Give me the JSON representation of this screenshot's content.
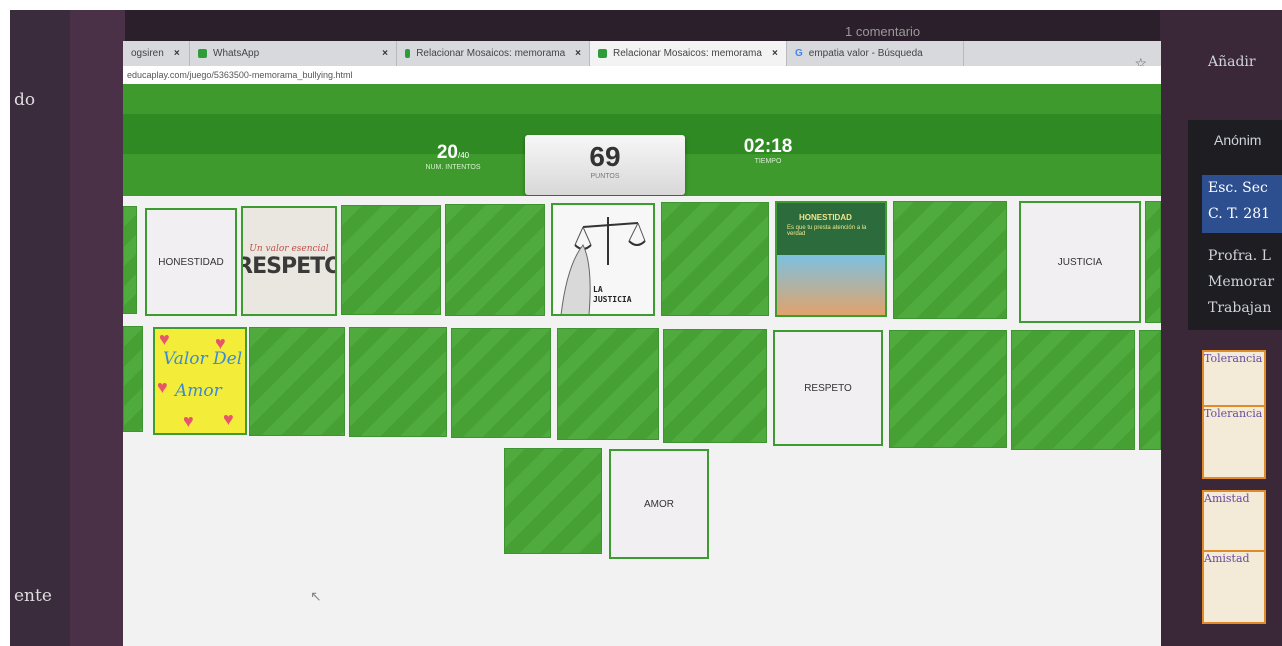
{
  "background": {
    "left_texts": [
      "do",
      "ente"
    ],
    "right_texts": [
      "Añadir",
      "Anónim",
      "Esc. Sec",
      "C. T. 281",
      "Profra. L",
      "Memorar",
      "Trabajan"
    ],
    "right_notes": [
      "Tolerancia",
      "Tolerancia",
      "Amistad",
      "Amistad"
    ],
    "top_text": "1 comentario"
  },
  "browser": {
    "tabs": [
      {
        "label": "ogsiren",
        "close": "×"
      },
      {
        "label": "WhatsApp",
        "close": "×"
      },
      {
        "label": "Relacionar Mosaicos: memorama",
        "close": "×"
      },
      {
        "label": "Relacionar Mosaicos: memorama",
        "close": "×",
        "active": true
      },
      {
        "label": "empatia valor - Búsqueda"
      }
    ],
    "url": "educaplay.com/juego/5363500-memorama_bullying.html",
    "bookmark_icon": "star-icon"
  },
  "game": {
    "attempts": {
      "value": "20",
      "max": "/40",
      "label": "NUM. INTENTOS"
    },
    "score": {
      "value": "69",
      "label": "PUNTOS"
    },
    "time": {
      "value": "02:18",
      "label": "TIEMPO"
    },
    "colors": {
      "green": "#4aa63a",
      "dark_green": "#2f8a24",
      "card_border": "#3c9c2f"
    },
    "cards": {
      "honestidad_word": "HONESTIDAD",
      "respeto_img_sub": "Un valor esencial",
      "respeto_img_title": "RESPETO",
      "justicia_img_label_1": "LA",
      "justicia_img_label_2": "JUSTICIA",
      "honestidad_img_title": "HONESTIDAD",
      "honestidad_img_line": "Es que tu presta atención a la verdad",
      "justicia_word": "JUSTICIA",
      "amor_img_1": "Valor Del",
      "amor_img_2": "Amor",
      "respeto_word": "RESPETO",
      "amor_word": "AMOR"
    }
  }
}
